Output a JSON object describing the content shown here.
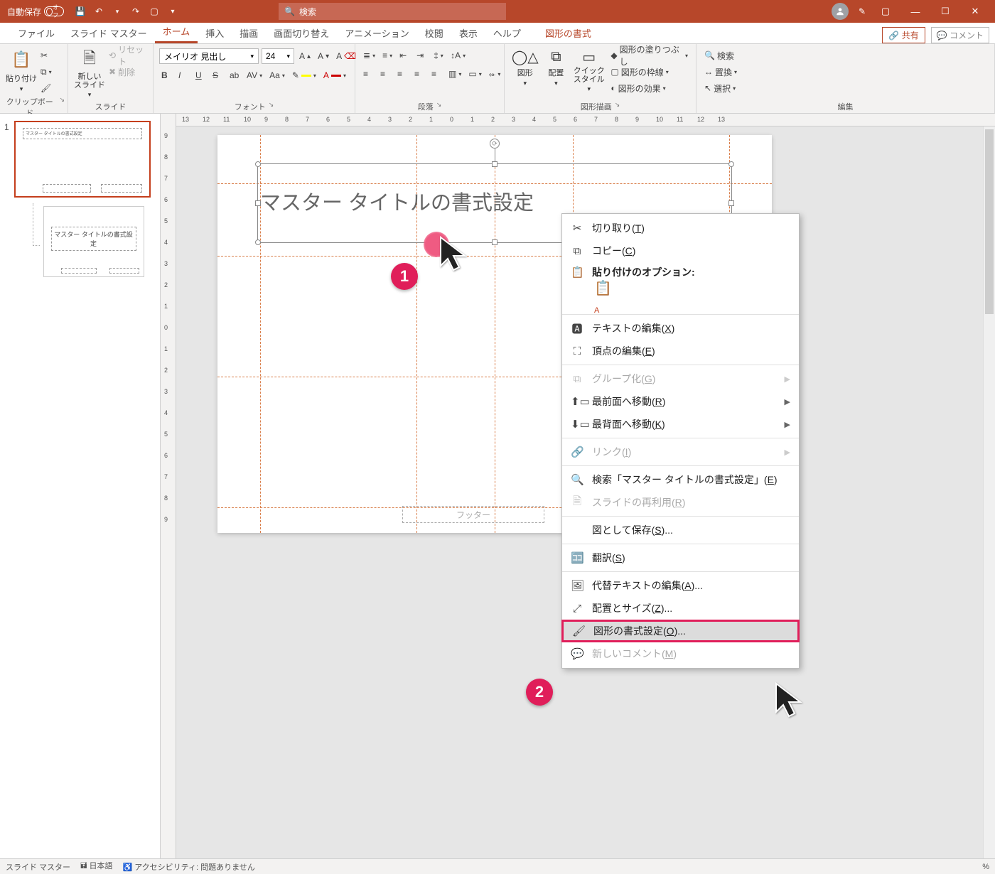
{
  "titlebar": {
    "autosave_label": "自動保存",
    "autosave_state": "オフ",
    "search_placeholder": "検索"
  },
  "tabs": {
    "file": "ファイル",
    "slidemaster": "スライド マスター",
    "home": "ホーム",
    "insert": "挿入",
    "draw": "描画",
    "transitions": "画面切り替え",
    "animations": "アニメーション",
    "review": "校閲",
    "view": "表示",
    "help": "ヘルプ",
    "shapeformat": "図形の書式",
    "share": "共有",
    "comments": "コメント"
  },
  "ribbon": {
    "clipboard": {
      "label": "クリップボード",
      "paste": "貼り付け"
    },
    "slides": {
      "label": "スライド",
      "new": "新しい\nスライド",
      "reset": "リセット",
      "delete": "削除"
    },
    "font": {
      "label": "フォント",
      "name": "メイリオ 見出し",
      "size": "24"
    },
    "paragraph": {
      "label": "段落"
    },
    "drawing": {
      "label": "図形描画",
      "shapes": "図形",
      "arrange": "配置",
      "quickstyles": "クイック\nスタイル",
      "fill": "図形の塗りつぶし",
      "outline": "図形の枠線",
      "effects": "図形の効果"
    },
    "editing": {
      "label": "編集",
      "find": "検索",
      "replace": "置換",
      "select": "選択"
    }
  },
  "thumbs": {
    "num1": "1",
    "master_thumb_title": "マスター タイトルの書式設定",
    "layout_thumb_title": "マスター タイトルの書式設定"
  },
  "slide": {
    "title_text": "マスター タイトルの書式設定",
    "footer_label": "フッター"
  },
  "status": {
    "slidemaster": "スライド マスター",
    "lang": "日本語",
    "a11y": "アクセシビリティ: 問題ありません",
    "zoom": "%"
  },
  "ctx": {
    "cut": "切り取り(",
    "cut_k": "T",
    "cut2": ")",
    "copy": "コピー(",
    "copy_k": "C",
    "copy2": ")",
    "paste_header": "貼り付けのオプション:",
    "edittext": "テキストの編集(",
    "edittext_k": "X",
    "edittext2": ")",
    "editpoints": "頂点の編集(",
    "editpoints_k": "E",
    "editpoints2": ")",
    "group": "グループ化(",
    "group_k": "G",
    "group2": ")",
    "front": "最前面へ移動(",
    "front_k": "R",
    "front2": ")",
    "back": "最背面へ移動(",
    "back_k": "K",
    "back2": ")",
    "link": "リンク(",
    "link_k": "I",
    "link2": ")",
    "search": "検索「マスター タイトルの書式設定」(",
    "search_k": "E",
    "search2": ")",
    "reuse": "スライドの再利用(",
    "reuse_k": "R",
    "reuse2": ")",
    "savepic": "図として保存(",
    "savepic_k": "S",
    "savepic2": ")...",
    "translate": "翻訳(",
    "translate_k": "S",
    "translate2": ")",
    "alttext": "代替テキストの編集(",
    "alttext_k": "A",
    "alttext2": ")...",
    "sizepos": "配置とサイズ(",
    "sizepos_k": "Z",
    "sizepos2": ")...",
    "format": "図形の書式設定(",
    "format_k": "O",
    "format2": ")...",
    "newcomment": "新しいコメント(",
    "newcomment_k": "M",
    "newcomment2": ")"
  },
  "ruler_h": [
    "13",
    "12",
    "11",
    "10",
    "9",
    "8",
    "7",
    "6",
    "5",
    "4",
    "3",
    "2",
    "1",
    "0",
    "1",
    "2",
    "3",
    "4",
    "5",
    "6",
    "7",
    "8",
    "9",
    "10",
    "11",
    "12",
    "13"
  ],
  "ruler_v": [
    "9",
    "8",
    "7",
    "6",
    "5",
    "4",
    "3",
    "2",
    "1",
    "0",
    "1",
    "2",
    "3",
    "4",
    "5",
    "6",
    "7",
    "8",
    "9"
  ],
  "annotations": {
    "b1": "1",
    "b2": "2"
  }
}
